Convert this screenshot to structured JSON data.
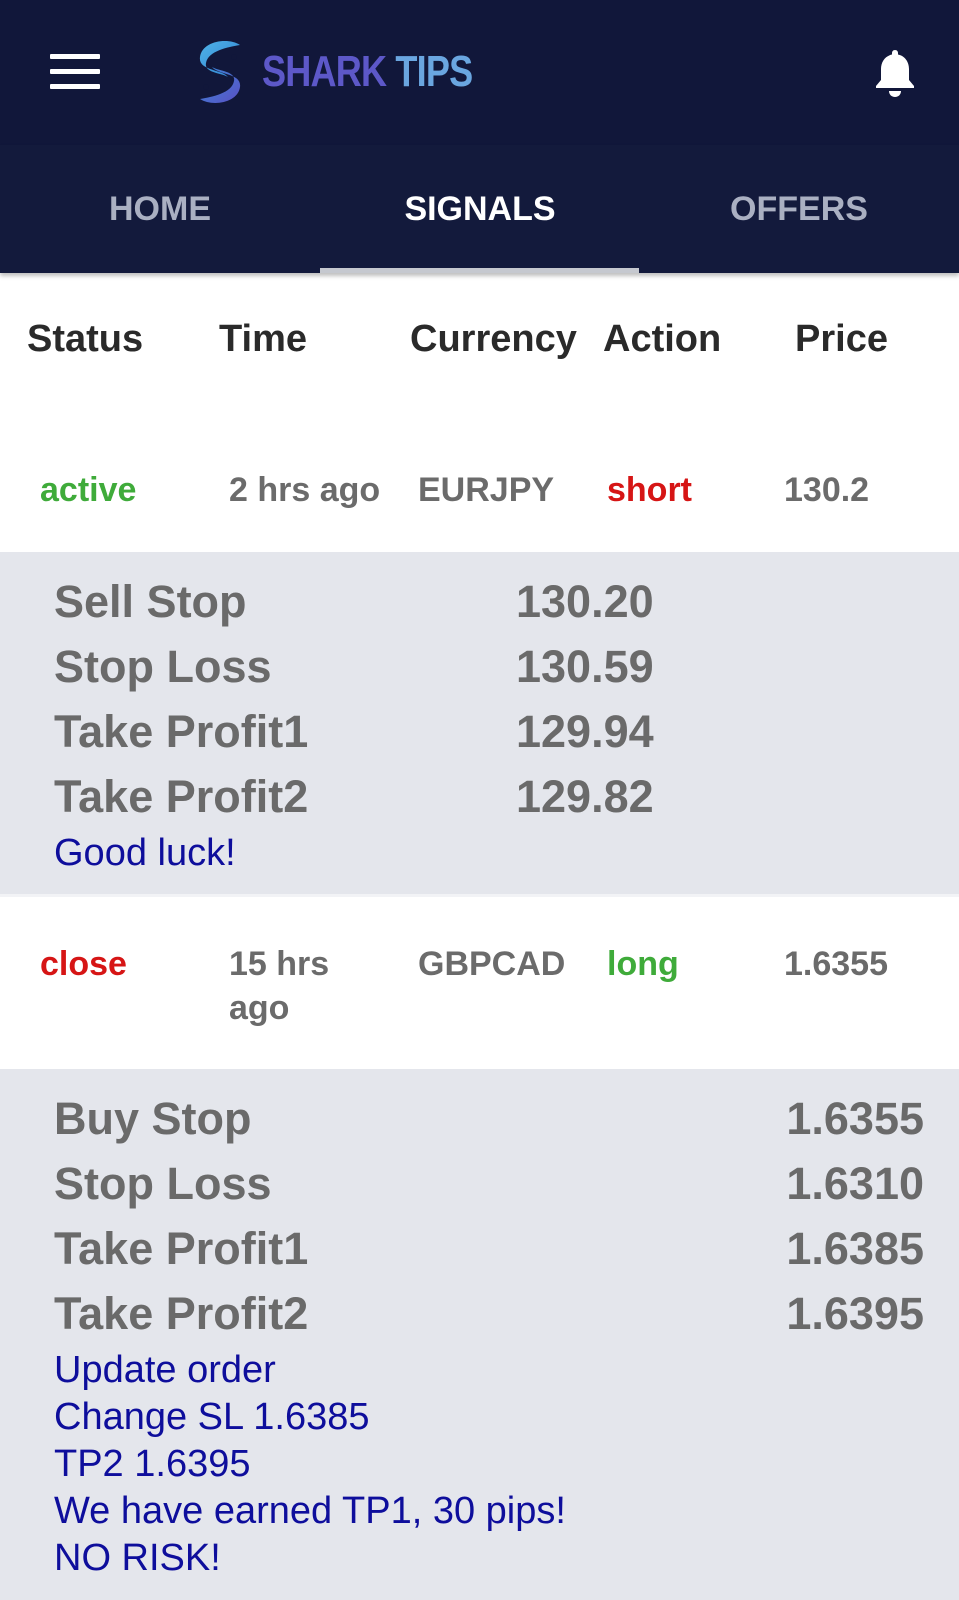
{
  "header": {
    "brand_word1": "SHARK",
    "brand_word2": "TIPS",
    "menu_icon": "hamburger-menu-icon",
    "notification_icon": "bell-icon"
  },
  "tabs": [
    {
      "label": "HOME",
      "active": false
    },
    {
      "label": "SIGNALS",
      "active": true
    },
    {
      "label": "OFFERS",
      "active": false
    }
  ],
  "table": {
    "columns": [
      "Status",
      "Time",
      "Currency",
      "Action",
      "Price"
    ]
  },
  "signals": [
    {
      "status": "active",
      "time_line1": "2 hrs ago",
      "time_line2": "",
      "currency": "EURJPY",
      "action": "short",
      "price": "130.2",
      "details": [
        {
          "label": "Sell Stop",
          "value": "130.20"
        },
        {
          "label": "Stop Loss",
          "value": "130.59"
        },
        {
          "label": "Take Profit1",
          "value": "129.94"
        },
        {
          "label": "Take Profit2",
          "value": "129.82"
        }
      ],
      "notes": [
        "Good luck!"
      ]
    },
    {
      "status": "close",
      "time_line1": "15 hrs",
      "time_line2": "ago",
      "currency": "GBPCAD",
      "action": "long",
      "price": "1.6355",
      "details": [
        {
          "label": "Buy Stop",
          "value": "1.6355"
        },
        {
          "label": "Stop Loss",
          "value": "1.6310"
        },
        {
          "label": "Take Profit1",
          "value": "1.6385"
        },
        {
          "label": "Take Profit2",
          "value": "1.6395"
        }
      ],
      "notes": [
        "Update order",
        "Change SL 1.6385",
        "TP2 1.6395",
        "We have earned TP1, 30 pips!",
        "NO RISK!"
      ]
    }
  ],
  "colors": {
    "header_bg": "#11173a",
    "status_active": "#3fab3a",
    "status_close": "#d61515",
    "action_short": "#d61515",
    "action_long": "#3fab3a",
    "note_text": "#0e0e9c",
    "panel_bg": "#e4e6ec"
  }
}
